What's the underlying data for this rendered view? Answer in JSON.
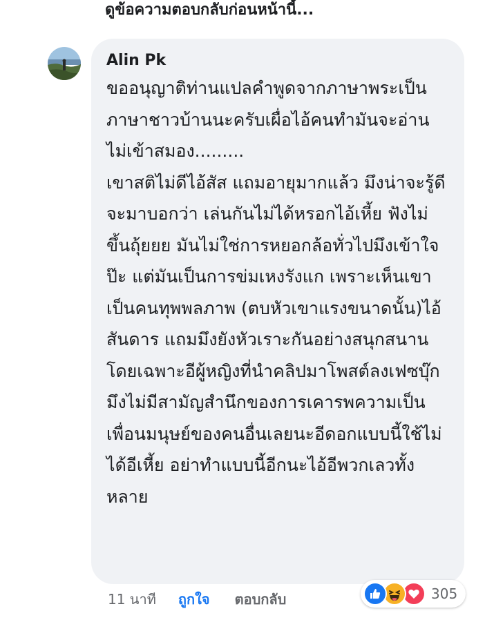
{
  "thread": {
    "view_previous_replies": "ดูข้อความตอบกลับก่อนหน้านี้..."
  },
  "comment": {
    "author": "Alin Pk",
    "text": "ขออนุญาติท่านแปลคำพูดจากภาษาพระเป็นภาษาชาวบ้านนะครับเผื่อไอ้คนทำมันจะอ่านไม่เข้าสมอง.........\nเขาสติไม่ดีไอ้สัส แถมอายุมากแล้ว มึงน่าจะรู้ดี จะมาบอกว่า เล่นกันไม่ได้หรอกไอ้เหี้ย ฟังไม่ขึ้นถุ้ยยย มันไม่ใช่การหยอกล้อทั่วไปมึงเข้าใจป๊ะ แต่มันเป็นการข่มเหงรังแก เพราะเห็นเขาเป็นคนทุพพลภาพ (ตบหัวเขาแรงขนาดนั้น)ไอ้สันดาร แถมมึงยังหัวเราะกันอย่างสนุกสนาน โดยเฉพาะอีผู้หญิงที่นำคลิปมาโพสต์ลงเฟซบุ๊ก มึงไม่มีสามัญสำนึกของการเคารพความเป็นเพื่อนมนุษย์ของคนอื่นเลยนะอีดอกแบบนี้ใช้ไม่ได้อีเหี้ย อย่าทำแบบนี้อีกนะไอ้อีพวกเลวทั้งหลาย",
    "time": "11 นาที",
    "like_label": "ถูกใจ",
    "reply_label": "ตอบกลับ",
    "reaction_count": "305",
    "reactions": [
      "like-icon",
      "haha-icon",
      "love-icon"
    ]
  },
  "colors": {
    "bubble_bg": "#f0f2f5",
    "like_blue": "#1877f2",
    "meta_gray": "#65676b",
    "haha_yellow": "#f7b125",
    "love_red": "#f33e58"
  }
}
